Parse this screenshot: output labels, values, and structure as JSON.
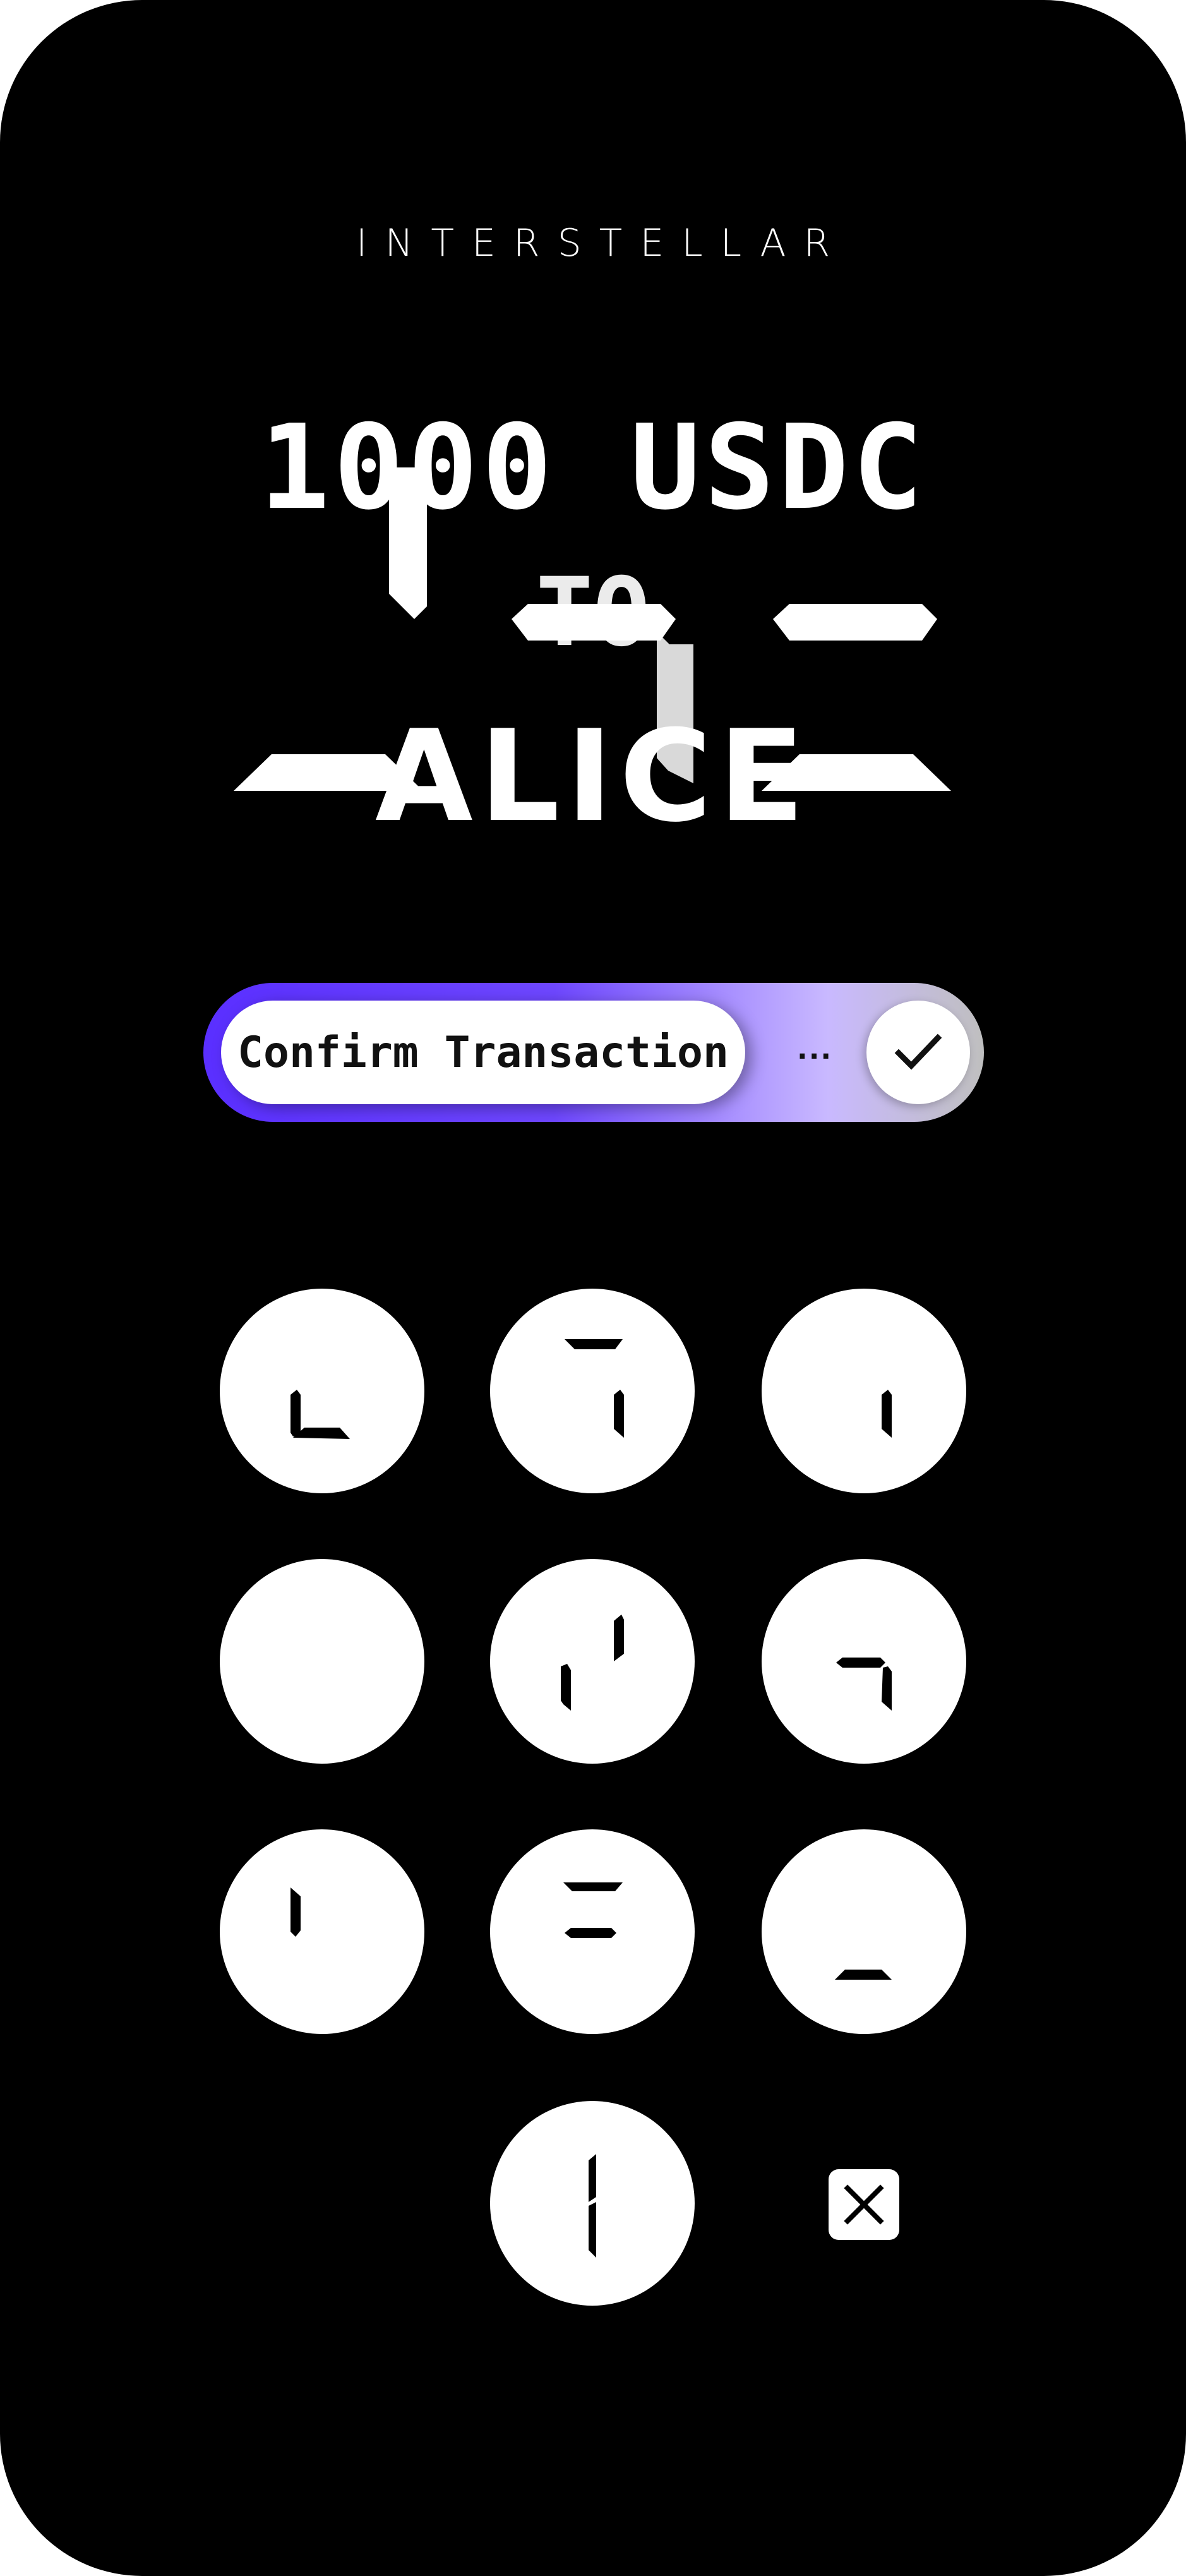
{
  "brand": {
    "name": "INTERSTELLAR"
  },
  "transaction": {
    "amount": "1000 USDC",
    "connector": "TO",
    "recipient": "ALICE"
  },
  "slider": {
    "label": "Confirm Transaction",
    "dots": "...",
    "confirm_icon": "checkmark-icon"
  },
  "keypad": {
    "keys": [
      {
        "icon": "segment-glyph-icon"
      },
      {
        "icon": "segment-glyph-icon"
      },
      {
        "icon": "segment-glyph-icon"
      },
      {
        "icon": "blank"
      },
      {
        "icon": "segment-glyph-icon"
      },
      {
        "icon": "segment-glyph-icon"
      },
      {
        "icon": "segment-glyph-icon"
      },
      {
        "icon": "segment-glyph-icon"
      },
      {
        "icon": "segment-glyph-icon"
      },
      {
        "icon": "segment-glyph-icon"
      }
    ],
    "delete_icon": "close-x-icon"
  },
  "colors": {
    "background": "#000000",
    "foreground": "#ffffff",
    "accent": "#6e47ff"
  }
}
